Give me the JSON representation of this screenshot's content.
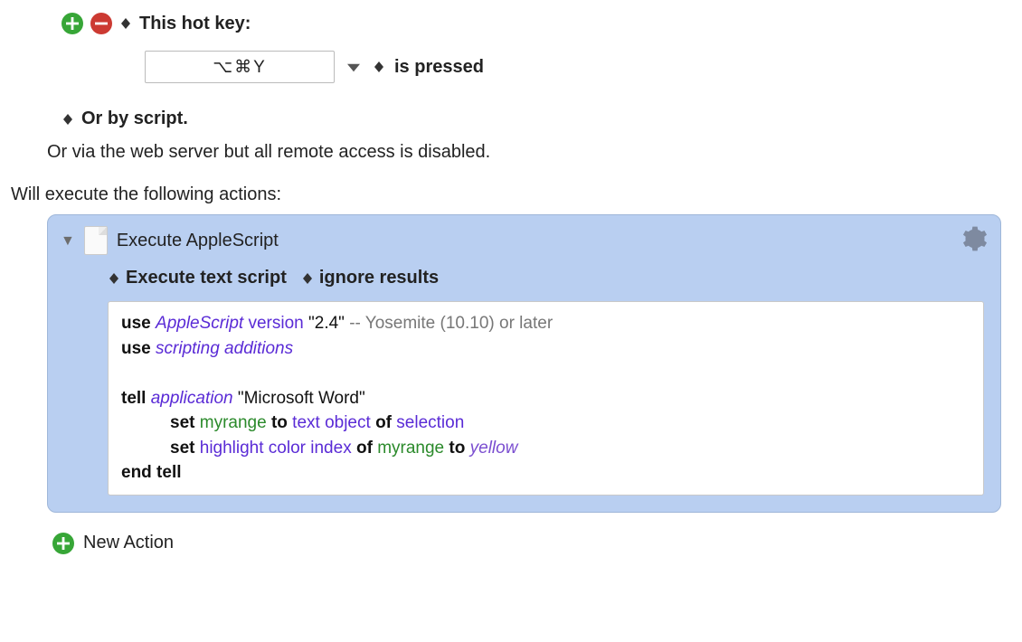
{
  "trigger": {
    "label_hotkey": "This hot key:",
    "hotkey_value": "⌥⌘Y",
    "label_is_pressed": "is pressed",
    "label_or_script": "Or by script.",
    "label_web": "Or via the web server but all remote access is disabled."
  },
  "section": {
    "exec_heading": "Will execute the following actions:"
  },
  "action": {
    "title": "Execute AppleScript",
    "option_1": "Execute text script",
    "option_2": "ignore results",
    "code": {
      "l1_kw1": "use",
      "l1_cls": "AppleScript",
      "l1_cls2": "version",
      "l1_str": "\"2.4\"",
      "l1_cmt": "-- Yosemite (10.10) or later",
      "l2_kw1": "use",
      "l2_cls": "scripting additions",
      "l4_kw1": "tell",
      "l4_cls": "application",
      "l4_str": "\"Microsoft Word\"",
      "l5_kw1": "set",
      "l5_var1": "myrange",
      "l5_kw2": "to",
      "l5_cls1": "text object",
      "l5_kw3": "of",
      "l5_cls2": "selection",
      "l6_kw1": "set",
      "l6_cls1": "highlight color index",
      "l6_kw2": "of",
      "l6_var1": "myrange",
      "l6_kw3": "to",
      "l6_enum": "yellow",
      "l7_kw1": "end tell"
    }
  },
  "footer": {
    "new_action": "New Action"
  }
}
